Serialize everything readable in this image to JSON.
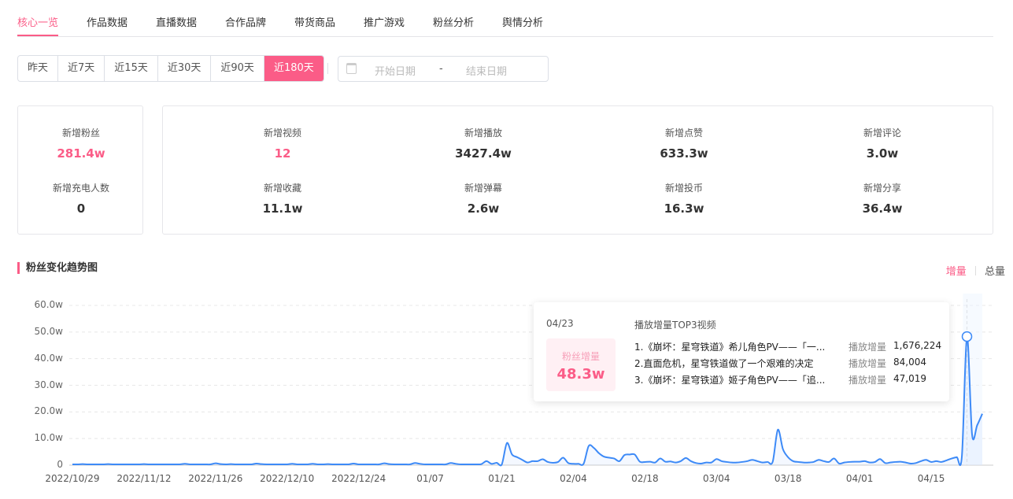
{
  "tabs": [
    "核心一览",
    "作品数据",
    "直播数据",
    "合作品牌",
    "带货商品",
    "推广游戏",
    "粉丝分析",
    "舆情分析"
  ],
  "ranges": [
    "昨天",
    "近7天",
    "近15天",
    "近30天",
    "近90天",
    "近180天"
  ],
  "date_range": {
    "start_placeholder": "开始日期",
    "separator": "-",
    "end_placeholder": "结束日期"
  },
  "fans_card": [
    {
      "label": "新增粉丝",
      "value": "281.4w"
    },
    {
      "label": "新增充电人数",
      "value": "0"
    }
  ],
  "stats": [
    {
      "label": "新增视频",
      "value": "12"
    },
    {
      "label": "新增播放",
      "value": "3427.4w"
    },
    {
      "label": "新增点赞",
      "value": "633.3w"
    },
    {
      "label": "新增评论",
      "value": "3.0w"
    },
    {
      "label": "新增收藏",
      "value": "11.1w"
    },
    {
      "label": "新增弹幕",
      "value": "2.6w"
    },
    {
      "label": "新增投币",
      "value": "16.3w"
    },
    {
      "label": "新增分享",
      "value": "36.4w"
    }
  ],
  "section": {
    "title": "粉丝变化趋势图",
    "toggle_increment": "增量",
    "toggle_total": "总量"
  },
  "tooltip": {
    "date": "04/23",
    "header": "播放增量TOP3视频",
    "fan_label": "粉丝增量",
    "fan_value": "48.3w",
    "videos": [
      {
        "title": "1.《崩坏：星穹铁道》希儿角色PV——「一...",
        "key": "播放增量",
        "value": "1,676,224"
      },
      {
        "title": "2.直面危机，星穹铁道做了一个艰难的决定",
        "key": "播放增量",
        "value": "84,004"
      },
      {
        "title": "3.《崩坏：星穹铁道》姬子角色PV——「追...",
        "key": "播放增量",
        "value": "47,019"
      }
    ]
  },
  "chart_data": {
    "type": "area",
    "unit": "w",
    "ylim": [
      0,
      60
    ],
    "yticks": [
      "60.0w",
      "50.0w",
      "40.0w",
      "30.0w",
      "20.0w",
      "10.0w",
      "0"
    ],
    "ytick_values": [
      60,
      50,
      40,
      30,
      20,
      10,
      0
    ],
    "xticks": [
      "2022/10/29",
      "2022/11/12",
      "2022/11/26",
      "2022/12/10",
      "2022/12/24",
      "01/07",
      "01/21",
      "02/04",
      "02/18",
      "03/04",
      "03/18",
      "04/01",
      "04/15"
    ],
    "xtick_step_days": 14,
    "start_date": "2022/10/29",
    "highlight_index": 175,
    "color": "#3d8af7",
    "values": [
      0.3,
      0.3,
      0.4,
      0.3,
      0.3,
      0.3,
      0.3,
      0.4,
      0.3,
      0.3,
      0.3,
      0.3,
      0.3,
      0.3,
      0.4,
      0.3,
      0.3,
      0.3,
      0.3,
      0.3,
      0.3,
      0.3,
      0.5,
      0.3,
      0.3,
      0.3,
      0.3,
      0.3,
      0.7,
      0.4,
      0.3,
      0.4,
      0.3,
      0.3,
      0.3,
      0.3,
      0.6,
      0.4,
      0.3,
      0.3,
      0.3,
      0.3,
      0.3,
      0.5,
      0.3,
      0.3,
      0.3,
      0.5,
      0.3,
      0.3,
      0.4,
      0.3,
      0.3,
      0.3,
      0.3,
      0.6,
      0.3,
      0.3,
      0.3,
      0.3,
      0.3,
      0.7,
      0.4,
      0.3,
      0.3,
      0.3,
      0.3,
      0.8,
      0.5,
      0.3,
      0.3,
      0.3,
      0.3,
      0.3,
      0.8,
      0.5,
      0.3,
      0.3,
      0.3,
      0.3,
      0.4,
      1.5,
      0.5,
      0.9,
      0.3,
      8.3,
      4.0,
      3.0,
      2.0,
      1.0,
      1.5,
      1.5,
      2.2,
      1.2,
      0.9,
      1.2,
      2.8,
      0.8,
      0.5,
      0.5,
      0.5,
      7.2,
      6.5,
      4.5,
      3.2,
      2.8,
      2.5,
      1.5,
      3.8,
      4.0,
      4.0,
      1.3,
      1.2,
      1.3,
      1.0,
      2.5,
      1.3,
      1.4,
      1.0,
      1.5,
      2.7,
      1.5,
      0.8,
      0.6,
      1.0,
      1.0,
      2.3,
      1.5,
      1.2,
      1.0,
      1.0,
      1.2,
      1.5,
      2.0,
      1.5,
      1.0,
      1.2,
      1.3,
      13.3,
      6.0,
      3.0,
      1.5,
      1.2,
      1.0,
      1.0,
      1.2,
      2.0,
      1.5,
      1.2,
      2.5,
      0.6,
      1.0,
      1.2,
      1.3,
      1.3,
      1.5,
      1.0,
      1.2,
      2.3,
      0.8,
      1.0,
      1.2,
      1.3,
      1.0,
      0.6,
      0.8,
      1.5,
      2.0,
      1.2,
      1.5,
      1.2,
      1.8,
      2.5,
      3.0,
      3.2,
      48.3,
      11.5,
      15.0,
      19.3
    ]
  }
}
